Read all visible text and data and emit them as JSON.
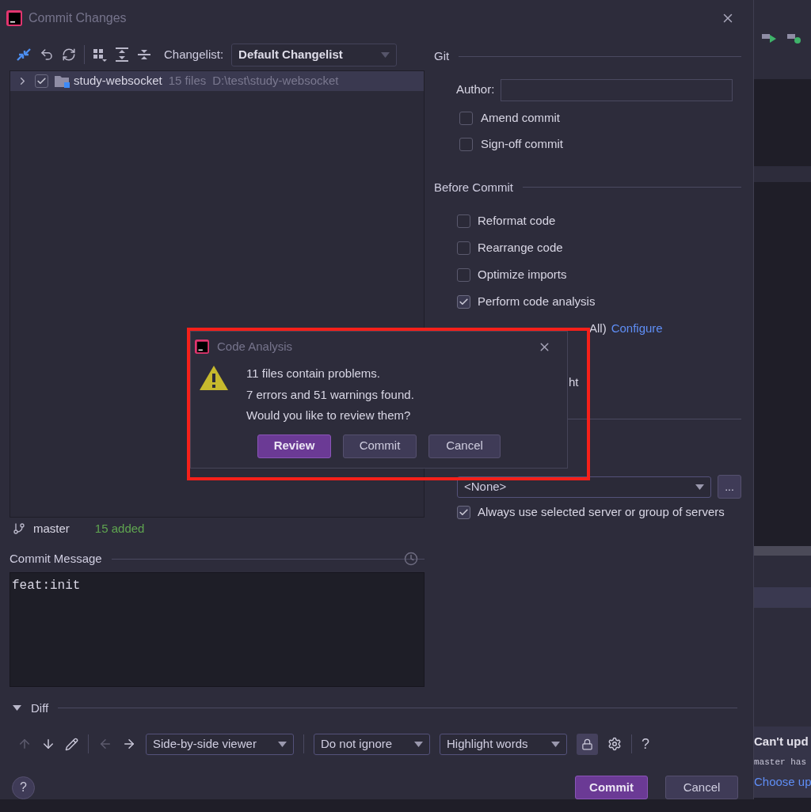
{
  "window": {
    "title": "Commit Changes"
  },
  "toolbar": {
    "changelist_label": "Changelist:",
    "changelist": "Default Changelist"
  },
  "tree": [
    {
      "name": "study-websocket",
      "count": "15 files",
      "path": "D:\\test\\study-websocket",
      "checked": true,
      "selected": true
    }
  ],
  "status": {
    "branch": "master",
    "summary": "15 added"
  },
  "commit_message": {
    "label": "Commit Message",
    "value": "feat:init"
  },
  "git": {
    "title": "Git",
    "author_label": "Author:",
    "options": [
      {
        "label": "Amend commit",
        "checked": false
      },
      {
        "label": "Sign-off commit",
        "checked": false
      }
    ]
  },
  "before_commit": {
    "title": "Before Commit",
    "options": [
      {
        "label": "Reformat code",
        "checked": false
      },
      {
        "label": "Rearrange code",
        "checked": false
      },
      {
        "label": "Optimize imports",
        "checked": false
      },
      {
        "label": "Perform code analysis",
        "checked": true
      }
    ],
    "fragments": [
      {
        "text": "All)",
        "link": "Configure"
      },
      {
        "text": "ht"
      }
    ]
  },
  "after_commit": {
    "server": "<None>",
    "more": "...",
    "always": {
      "label": "Always use selected server or group of servers",
      "checked": true
    }
  },
  "diff": {
    "title": "Diff",
    "expanded": true,
    "viewer": "Side-by-side viewer",
    "ignore": "Do not ignore",
    "highlight": "Highlight words",
    "help": "?"
  },
  "help": "?",
  "buttons": [
    {
      "label": "Commit",
      "primary": true
    },
    {
      "label": "Cancel",
      "primary": false
    }
  ],
  "dialog": {
    "title": "Code Analysis",
    "lines": [
      "11 files contain problems.",
      "7 errors and 51 warnings found.",
      "Would you like to review them?"
    ],
    "buttons": [
      {
        "label": "Review",
        "primary": true
      },
      {
        "label": "Commit",
        "primary": false
      },
      {
        "label": "Cancel",
        "primary": false
      }
    ]
  },
  "notification": {
    "title": "Can't upd",
    "body": "master has",
    "link": "Choose up"
  }
}
